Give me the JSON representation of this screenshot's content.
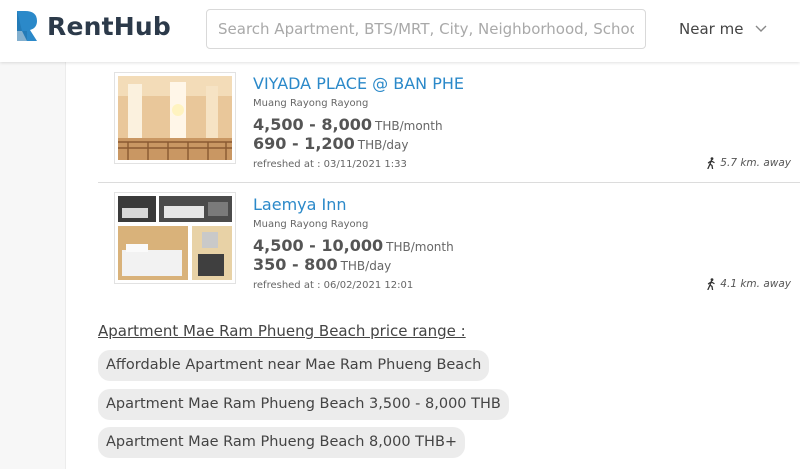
{
  "header": {
    "brand": "RentHub",
    "search_placeholder": "Search Apartment, BTS/MRT, City, Neighborhood, School",
    "near_me_label": "Near me",
    "brand_color": "#2b89c9"
  },
  "listings": [
    {
      "title": "VIYADA PLACE @ BAN PHE",
      "location": "Muang Rayong Rayong",
      "price_month": "4,500 - 8,000",
      "price_month_unit": "THB/month",
      "price_day": "690 - 1,200",
      "price_day_unit": "THB/day",
      "refreshed": "refreshed at : 03/11/2021 1:33",
      "distance": "5.7 km. away"
    },
    {
      "title": "Laemya Inn",
      "location": "Muang Rayong Rayong",
      "price_month": "4,500 - 10,000",
      "price_month_unit": "THB/month",
      "price_day": "350 - 800",
      "price_day_unit": "THB/day",
      "refreshed": "refreshed at : 06/02/2021 12:01",
      "distance": "4.1 km. away"
    }
  ],
  "price_range": {
    "heading": "Apartment Mae Ram Phueng Beach price range :",
    "links": [
      "Affordable Apartment near Mae Ram Phueng Beach",
      "Apartment Mae Ram Phueng Beach 3,500 - 8,000 THB",
      "Apartment Mae Ram Phueng Beach 8,000 THB+"
    ]
  }
}
